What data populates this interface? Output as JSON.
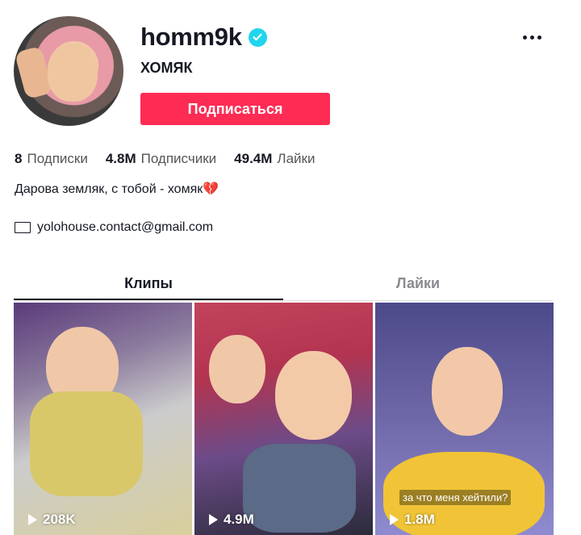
{
  "profile": {
    "username": "homm9k",
    "nickname": "ХОМЯК",
    "follow_label": "Подписаться",
    "bio": "Дарова земляк, с тобой - хомяк💔",
    "email": "yolohouse.contact@gmail.com",
    "verified_color": "#20d5ec",
    "follow_color": "#fe2c55"
  },
  "stats": [
    {
      "value": "8",
      "label": "Подписки"
    },
    {
      "value": "4.8M",
      "label": "Подписчики"
    },
    {
      "value": "49.4M",
      "label": "Лайки"
    }
  ],
  "tabs": [
    {
      "label": "Клипы",
      "active": true
    },
    {
      "label": "Лайки",
      "active": false
    }
  ],
  "videos": [
    {
      "views": "208K",
      "caption": ""
    },
    {
      "views": "4.9M",
      "caption": ""
    },
    {
      "views": "1.8M",
      "caption": "за что меня хейтили?"
    }
  ]
}
